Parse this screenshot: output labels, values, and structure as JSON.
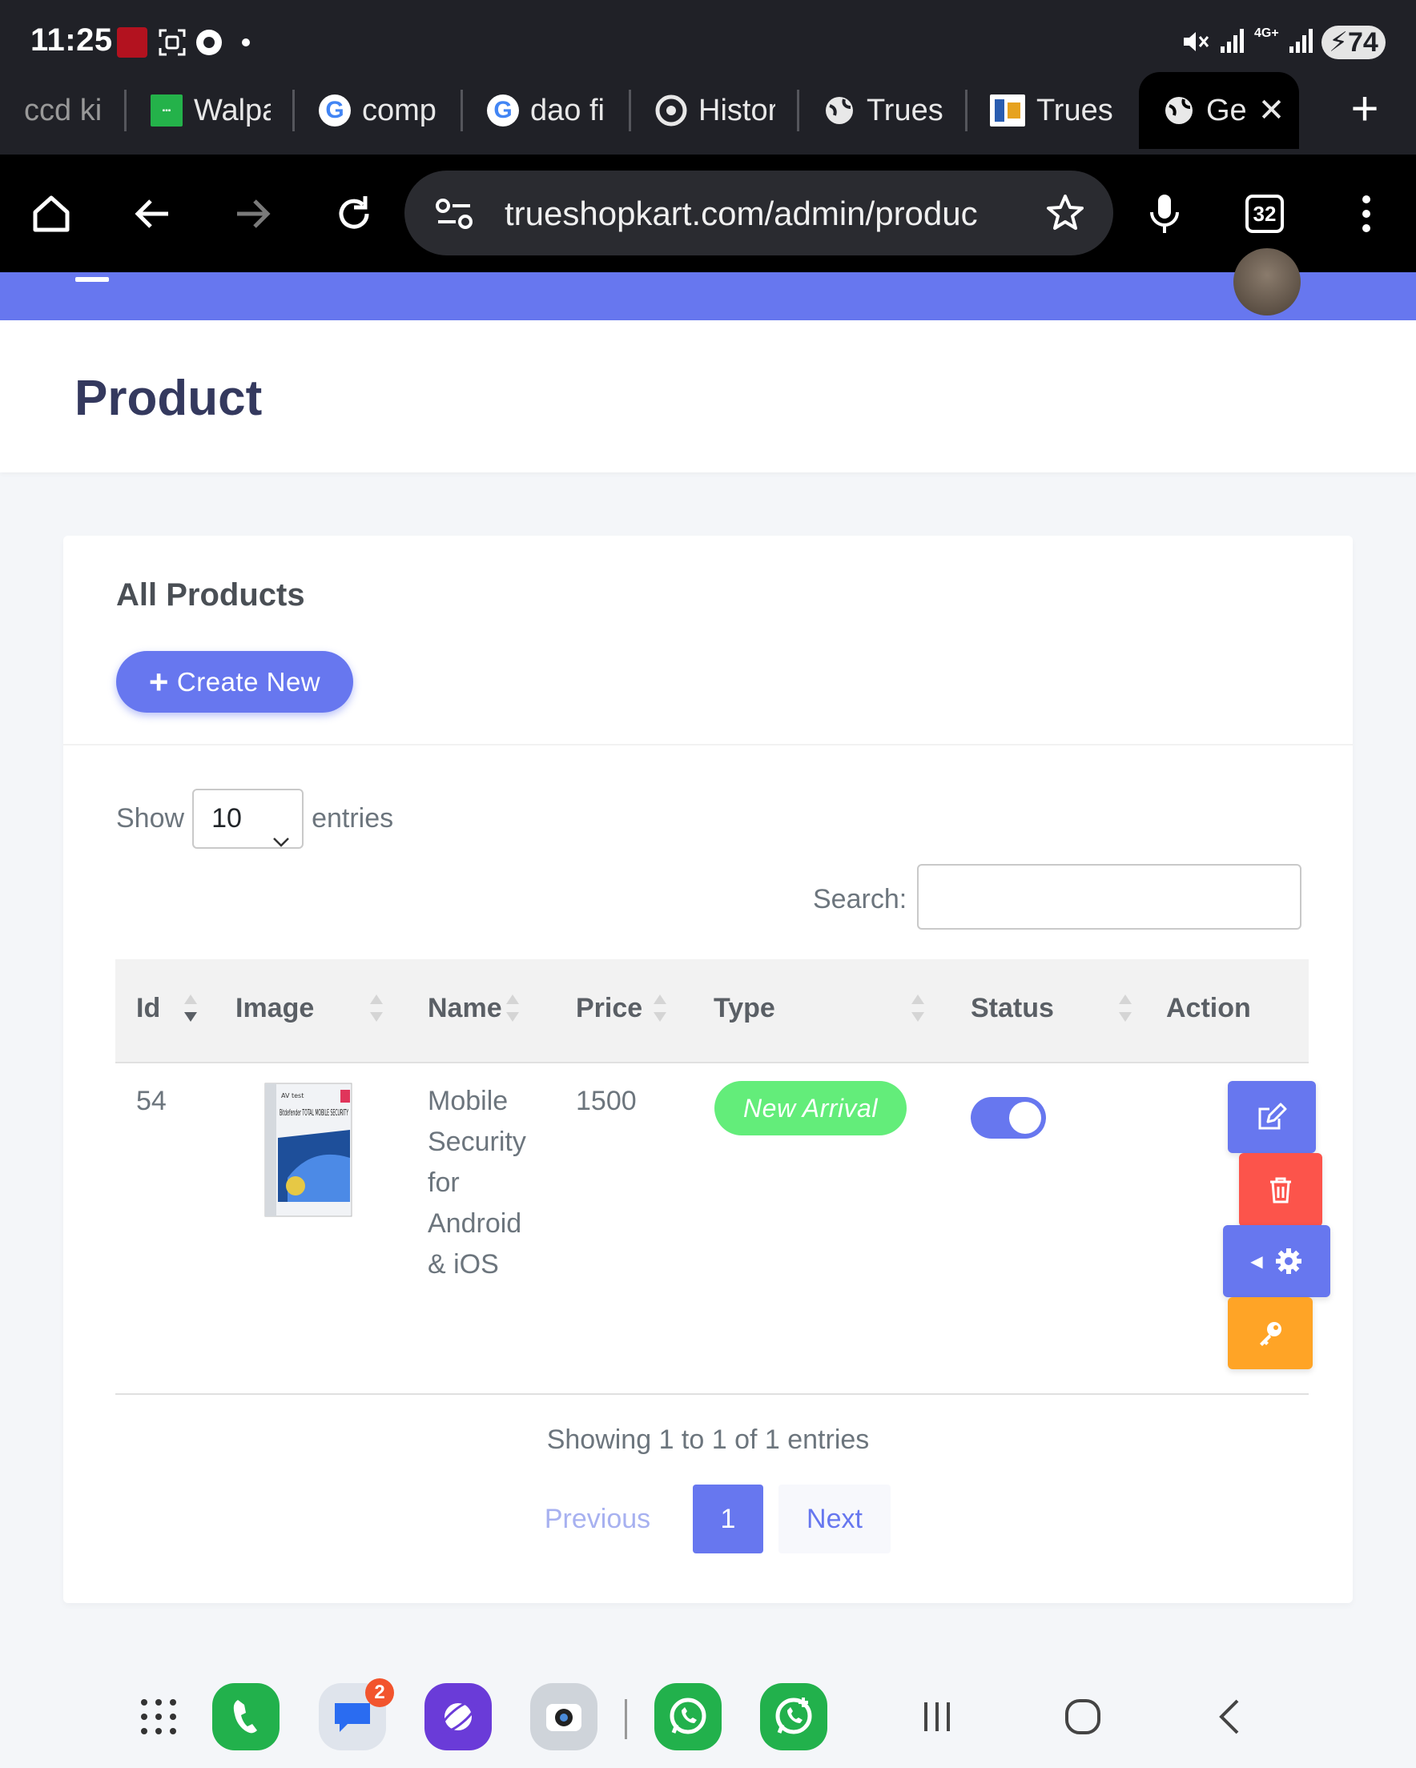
{
  "status_bar": {
    "time": "11:25",
    "battery": "74",
    "network": "4G+"
  },
  "tabs": [
    {
      "label": "ccd ki",
      "icon": "generic-page-icon"
    },
    {
      "label": "Walpa",
      "icon": "wallpaper-site-icon"
    },
    {
      "label": "comp",
      "icon": "google-icon"
    },
    {
      "label": "dao fi",
      "icon": "google-icon"
    },
    {
      "label": "Histor",
      "icon": "history-icon"
    },
    {
      "label": "Trues",
      "icon": "globe-icon"
    },
    {
      "label": "Trues",
      "icon": "trueshopkart-icon"
    },
    {
      "label": "Ge",
      "icon": "globe-icon",
      "active": true
    }
  ],
  "browser": {
    "url": "trueshopkart.com/admin/produc",
    "tab_count": "32"
  },
  "page": {
    "title": "Product"
  },
  "card": {
    "title": "All Products",
    "create_button": "Create New",
    "show_label": "Show",
    "entries_value": "10",
    "entries_label": "entries",
    "search_label": "Search:",
    "search_value": ""
  },
  "table": {
    "columns": [
      "Id",
      "Image",
      "Name",
      "Price",
      "Type",
      "Status",
      "Action"
    ],
    "rows": [
      {
        "id": "54",
        "image": "Bitdefender TOTAL MOBILE SECURITY",
        "name_lines": [
          "Mobile",
          "Security",
          "for",
          "Android",
          "& iOS"
        ],
        "price": "1500",
        "type": "New Arrival",
        "status_on": true
      }
    ]
  },
  "pagination": {
    "info": "Showing 1 to 1 of 1 entries",
    "previous": "Previous",
    "current": "1",
    "next": "Next"
  },
  "dock": {
    "messages_badge": "2"
  },
  "colors": {
    "primary": "#6777ef",
    "success": "#63ed7a",
    "danger": "#fc544b",
    "warning": "#ffa426"
  }
}
